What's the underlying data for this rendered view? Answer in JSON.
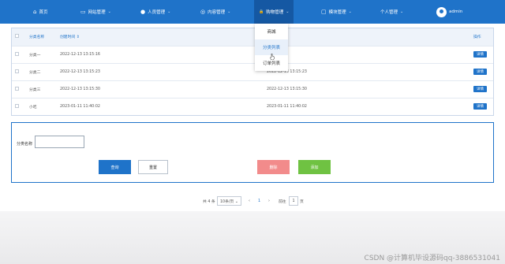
{
  "nav": {
    "items": [
      {
        "icon": "⌂",
        "label": "首页",
        "chevron": ""
      },
      {
        "icon": "▭",
        "label": "网站管理",
        "chevron": "⌄"
      },
      {
        "icon": "●",
        "label": "人员管理",
        "chevron": "⌄"
      },
      {
        "icon": "◎",
        "label": "内容管理",
        "chevron": "⌄"
      },
      {
        "icon": "🔒",
        "label": "购物管理",
        "chevron": "⌄"
      },
      {
        "icon": "▢",
        "label": "模块管理",
        "chevron": "⌄"
      },
      {
        "icon": "",
        "label": "个人管理",
        "chevron": "⌄"
      }
    ],
    "user": "admin"
  },
  "dropdown": {
    "items": [
      "商城",
      "分类列表",
      "订单列表"
    ]
  },
  "table": {
    "headers": [
      "分类名称",
      "创建时间 ⇕",
      "",
      "操作"
    ],
    "rows": [
      {
        "name": "分类一",
        "created": "2022-12-13 13:15:16",
        "updated": "",
        "action": "详情"
      },
      {
        "name": "分类二",
        "created": "2022-12-13 13:15:23",
        "updated": "2022-12-13 13:15:23",
        "action": "详情"
      },
      {
        "name": "分类三",
        "created": "2022-12-13 13:15:30",
        "updated": "2022-12-13 13:15:30",
        "action": "详情"
      },
      {
        "name": "小吃",
        "created": "2023-01-11 11:40:02",
        "updated": "2023-01-11 11:40:02",
        "action": "详情"
      }
    ]
  },
  "search": {
    "label": "分类名称",
    "value": "",
    "query_label": "查询",
    "reset_label": "重置",
    "delete_label": "删除",
    "add_label": "添加"
  },
  "pager": {
    "total": "共 4 条",
    "size": "10条/页 ⌄",
    "prev": "‹",
    "current": "1",
    "next": "›",
    "goto_prefix": "前往",
    "goto_value": "1",
    "goto_suffix": "页"
  },
  "watermark": "CSDN @计算机毕设源码qq-3886531041",
  "colors": {
    "primary": "#1f73c9",
    "delete": "#f28b8b",
    "add": "#6fc242"
  }
}
